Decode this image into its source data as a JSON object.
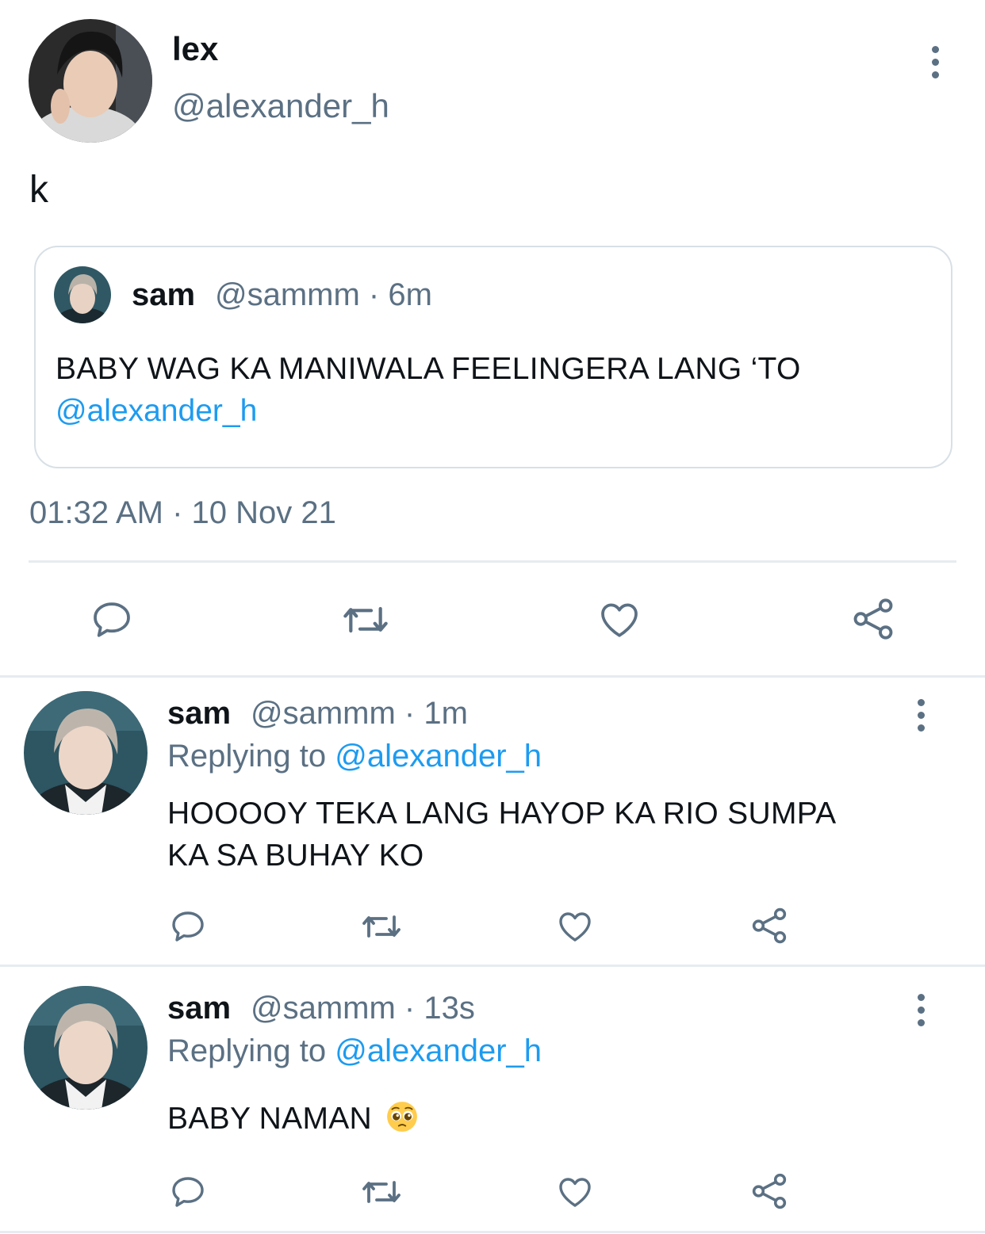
{
  "main_tweet": {
    "name": "lex",
    "handle": "@alexander_h",
    "text": "k",
    "timestamp": "01:32 AM · 10 Nov 21",
    "quoted": {
      "name": "sam",
      "meta": "@sammm · 6m",
      "text": "BABY WAG KA MANIWALA FEELINGERA LANG ‘TO",
      "mention": "@alexander_h"
    }
  },
  "replies": [
    {
      "name": "sam",
      "meta": "@sammm · 1m",
      "replying_prefix": "Replying to",
      "replying_handle": "@alexander_h",
      "text_line1": "HOOOOY TEKA LANG HAYOP KA RIO SUMPA",
      "text_line2": "KA SA BUHAY KO"
    },
    {
      "name": "sam",
      "meta": "@sammm · 13s",
      "replying_prefix": "Replying to",
      "replying_handle": "@alexander_h",
      "text": "BABY NAMAN",
      "emoji": "pleading-face"
    }
  ],
  "icons": {
    "action_color": "#5b7083",
    "link_color": "#1d9bf0"
  }
}
